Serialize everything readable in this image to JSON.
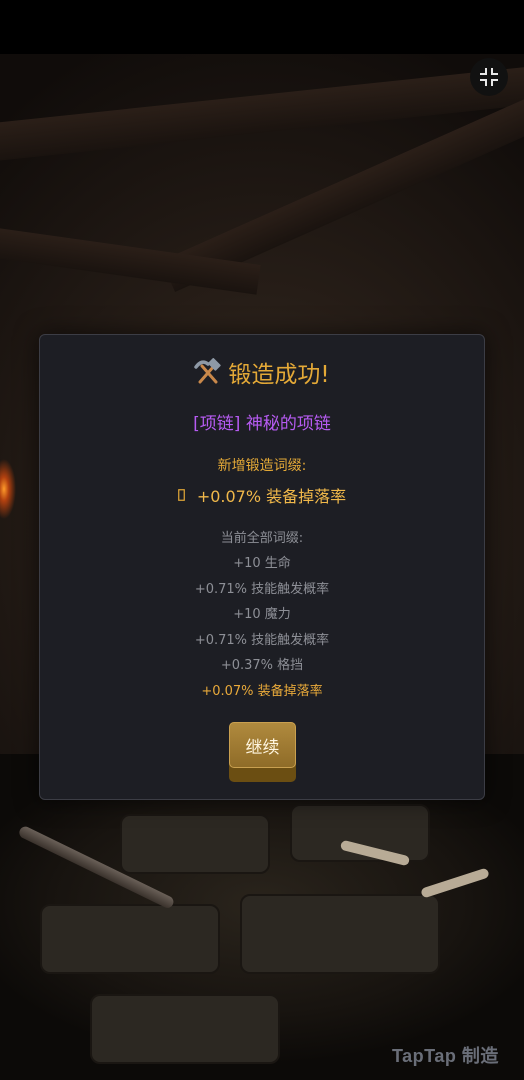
{
  "dialog": {
    "title": "锻造成功!",
    "title_icon": "hammer-pick-icon",
    "item_name": "[项链] 神秘的项链",
    "new_affix_title": "新增锻造词缀:",
    "new_affix_icon": "missing-glyph-icon",
    "new_affix": "+0.07% 装备掉落率",
    "current_affixes_title": "当前全部词缀:",
    "current_affixes": [
      "+10 生命",
      "+0.71% 技能触发概率",
      "+10 魔力",
      "+0.71% 技能触发概率",
      "+0.37% 格挡",
      "+0.07% 装备掉落率"
    ],
    "continue_label": "继续"
  },
  "controls": {
    "fullscreen_icon": "exit-fullscreen-icon"
  },
  "watermark": "TapTap 制造",
  "colors": {
    "accent_gold": "#e4a937",
    "item_purple": "#b65bf2",
    "muted_text": "#8d8f96",
    "dialog_bg": "#1d1e24"
  }
}
